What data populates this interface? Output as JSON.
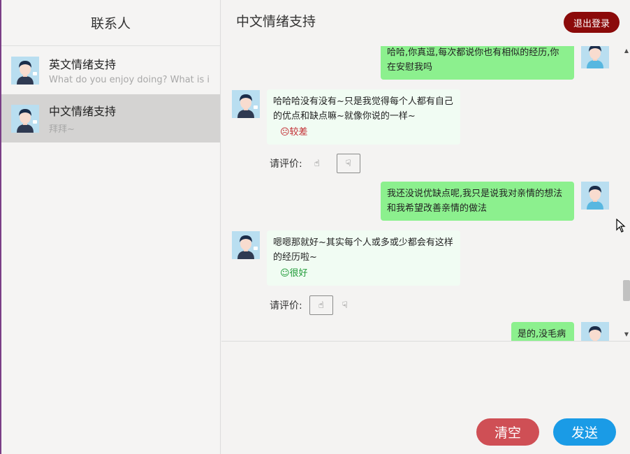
{
  "sidebar": {
    "title": "联系人",
    "contacts": [
      {
        "name": "英文情绪支持",
        "preview": "What do you enjoy doing? What is it"
      },
      {
        "name": "中文情绪支持",
        "preview": "拜拜~"
      }
    ]
  },
  "chat": {
    "title": "中文情绪支持",
    "logout_label": "退出登录",
    "messages": [
      {
        "from": "me",
        "text": "哈哈,你真逗,每次都说你也有相似的经历,你在安慰我吗"
      },
      {
        "from": "bot",
        "text": "哈哈哈没有没有~只是我觉得每个人都有自己的优点和缺点嘛~就像你说的一样~",
        "rating": "☹较差"
      },
      {
        "from": "me",
        "text": "我还没说优缺点呢,我只是说我对亲情的想法和我希望改善亲情的做法"
      },
      {
        "from": "bot",
        "text": "嗯嗯那就好~其实每个人或多或少都会有这样的经历啦~",
        "rating": "☺很好"
      },
      {
        "from": "me",
        "text": "是的,没毛病"
      }
    ],
    "eval_label": "请评价:",
    "thumb_up_icon": "☝",
    "thumb_down_icon": "☟"
  },
  "input": {
    "clear_label": "清空",
    "send_label": "发送"
  }
}
